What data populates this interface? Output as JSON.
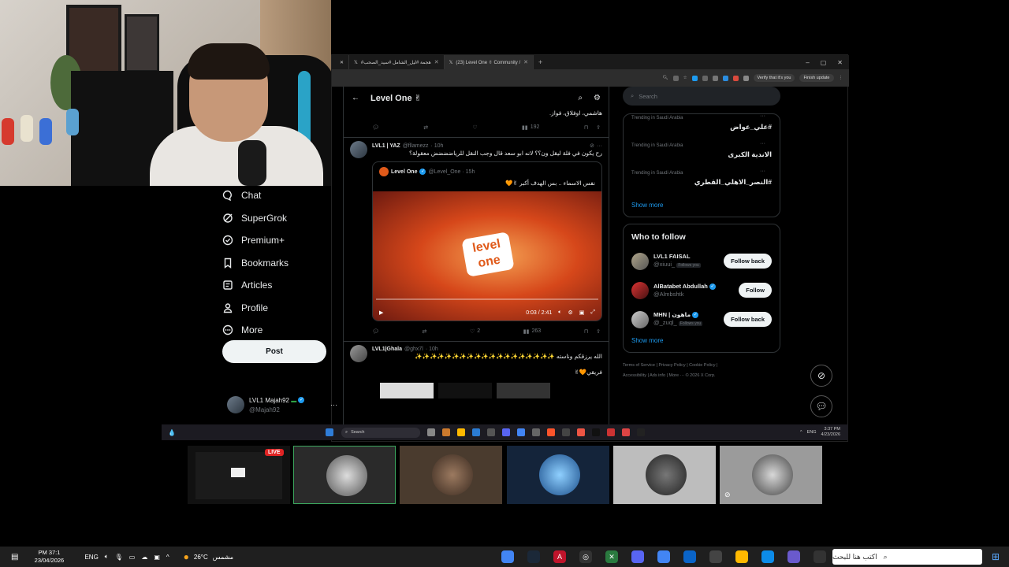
{
  "browser": {
    "tabs": [
      {
        "label": "#هجمة #ليل_الشامل #سيد_الصحب"
      },
      {
        "label": "(23) Level One ✌ Community /"
      }
    ],
    "toolbar": {
      "verify_label": "Verify that it's you",
      "finish_update_label": "Finish update"
    }
  },
  "nav": {
    "items": [
      {
        "label": "Chat",
        "icon": "chat-icon"
      },
      {
        "label": "SuperGrok",
        "icon": "grok-icon"
      },
      {
        "label": "Premium+",
        "icon": "premium-icon"
      },
      {
        "label": "Bookmarks",
        "icon": "bookmark-icon"
      },
      {
        "label": "Articles",
        "icon": "articles-icon"
      },
      {
        "label": "Profile",
        "icon": "profile-icon"
      },
      {
        "label": "More",
        "icon": "more-icon"
      }
    ],
    "post_label": "Post",
    "account": {
      "name": "LVL1 Majah92",
      "handle": "@Majah92"
    }
  },
  "feed": {
    "title": "Level One ✌",
    "prev_tweet": {
      "text": "هاشمي، اوفلاق، فواز.",
      "views": "192"
    },
    "tweet1": {
      "author": "LVL1 | YAZ",
      "handle": "@fllamezz",
      "time": "· 10h",
      "text": "رح يكون في فلة ليقل ون؟؟ لانه ابو سعد قال وجب النقل للرياضضضض معقولة؟",
      "quote": {
        "author": "Level One",
        "handle": "@Level_One · 15h",
        "text": "نفس الاسماء .. بس الهدف أكبر ✌🧡",
        "logo_text": "level one",
        "video_time": "0:03 / 2:41"
      },
      "likes": "2",
      "views": "263"
    },
    "tweet2": {
      "author": "LVL1|Ghala",
      "handle": "@ghx7l",
      "time": "· 10h",
      "line1": "الله يرزقكم وناسته ✨✨✨✨✨✨✨✨✨✨✨✨✨✨✨✨✨✨✨",
      "line2": "فريقي🧡✌"
    }
  },
  "right": {
    "search_placeholder": "Search",
    "trends": [
      {
        "meta": "Trending in Saudi Arabia",
        "name": "#علي_عواض"
      },
      {
        "meta": "Trending in Saudi Arabia",
        "name": "الاندية الكبرى"
      },
      {
        "meta": "Trending in Saudi Arabia",
        "name": "#النصر_الاهلي_القطري"
      }
    ],
    "show_more": "Show more",
    "wtf_title": "Who to follow",
    "follows": [
      {
        "name": "LVL1 FAISAL",
        "handle": "@xiuui_",
        "badge": "Follows you",
        "button": "Follow back"
      },
      {
        "name": "AlBatabet Abdullah",
        "handle": "@Almbshtk",
        "badge": "",
        "button": "Follow"
      },
      {
        "name": "MHN | ماهون",
        "handle": "@_zuql_",
        "badge": "Follows you",
        "button": "Follow back"
      }
    ],
    "show_more2": "Show more",
    "footer1": "Terms of Service  |  Privacy Policy  |  Cookie Policy  |",
    "footer2": "Accessibility  |  Ads info  |  More ···  © 2026 X Corp."
  },
  "inner_taskbar": {
    "search": "Search",
    "lang": "ENG",
    "time": "3:37 PM",
    "date": "4/23/2026"
  },
  "stream": {
    "live_label": "LIVE"
  },
  "taskbar": {
    "time": "PM 37:1",
    "date": "23/04/2026",
    "lang": "ENG",
    "weather_temp": "26°C",
    "weather_label": "مشمس",
    "search_placeholder": "اكتب هنا للبحث"
  },
  "colors": {
    "accent": "#1d9bf0",
    "live": "#e02424",
    "bg": "#000000"
  }
}
